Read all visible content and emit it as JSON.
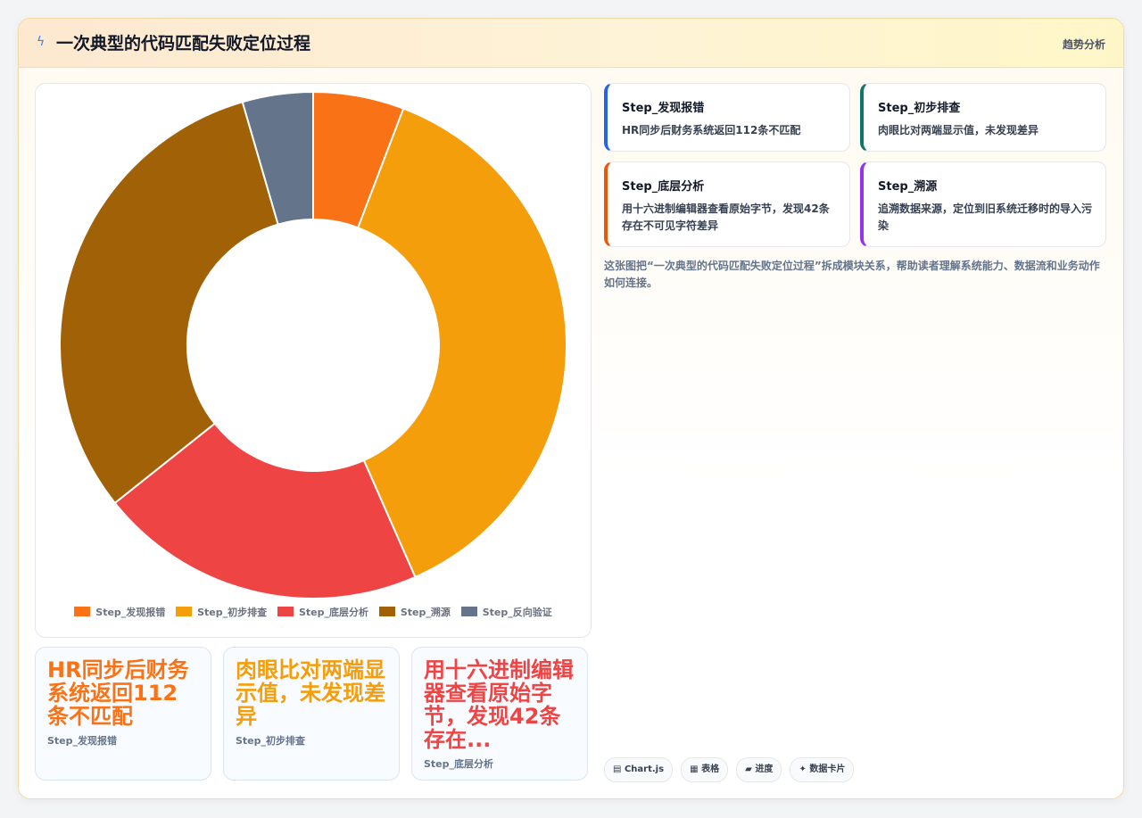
{
  "header": {
    "icon": "bolt-icon",
    "title": "一次典型的代码匹配失败定位过程",
    "right_link": "趋势分析"
  },
  "chart_data": {
    "type": "doughnut",
    "categories": [
      "Step_发现报错",
      "Step_初步排查",
      "Step_底层分析",
      "Step_溯源",
      "Step_反向验证"
    ],
    "values": [
      5.8,
      37.6,
      20.9,
      31.2,
      4.5
    ],
    "colors": [
      "#f97316",
      "#f59e0b",
      "#ef4444",
      "#a16207",
      "#64748b"
    ],
    "legend": "bottom"
  },
  "big_cards": [
    {
      "value": "HR同步后财务系统返回112条不匹配",
      "label": "Step_发现报错",
      "color": "#f97316"
    },
    {
      "value": "肉眼比对两端显示值，未发现差异",
      "label": "Step_初步排查",
      "color": "#f59e0b"
    },
    {
      "value": "用十六进制编辑器查看原始字节，发现42条存在...",
      "label": "Step_底层分析",
      "color": "#ef4444"
    }
  ],
  "steps": [
    {
      "title": "Step_发现报错",
      "desc": "HR同步后财务系统返回112条不匹配",
      "color": "#2563eb"
    },
    {
      "title": "Step_初步排查",
      "desc": "肉眼比对两端显示值，未发现差异",
      "color": "#0f766e"
    },
    {
      "title": "Step_底层分析",
      "desc": "用十六进制编辑器查看原始字节，发现42条存在不可见字符差异",
      "color": "#ea580c"
    },
    {
      "title": "Step_溯源",
      "desc": "追溯数据来源，定位到旧系统迁移时的导入污染",
      "color": "#9333ea"
    }
  ],
  "description": "这张图把“一次典型的代码匹配失败定位过程”拆成模块关系，帮助读者理解系统能力、数据流和业务动作如何连接。",
  "tags": [
    {
      "icon": "chart-icon",
      "glyph": "▤",
      "label": "Chart.js"
    },
    {
      "icon": "table-icon",
      "glyph": "▦",
      "label": "表格"
    },
    {
      "icon": "folder-icon",
      "glyph": "▰",
      "label": "进度"
    },
    {
      "icon": "sparkle-icon",
      "glyph": "✦",
      "label": "数据卡片"
    }
  ]
}
